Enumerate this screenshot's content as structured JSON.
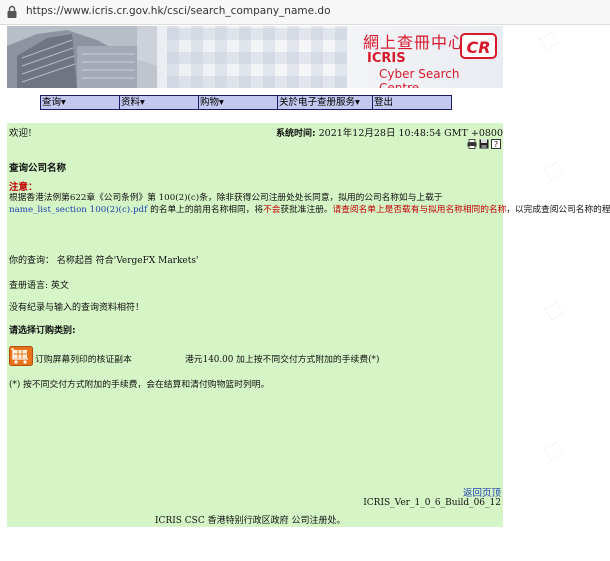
{
  "browser": {
    "url": "https://www.icris.cr.gov.hk/csci/search_company_name.do"
  },
  "banner": {
    "title_cn": "網上查冊中心",
    "title_en1": "ICRIS",
    "title_en2": "Cyber Search Centre",
    "logo": "CR"
  },
  "menu": {
    "items": [
      {
        "label": "查询▾"
      },
      {
        "label": "资料▾"
      },
      {
        "label": "购物▾"
      },
      {
        "label": "关於电子查册服务▾"
      },
      {
        "label": "登出"
      }
    ]
  },
  "main": {
    "welcome": "欢迎!",
    "system_time_label": "系统时间:",
    "system_time_value": "2021年12月28日 10:48:54 GMT +0800",
    "page_title": "查询公司名称",
    "notice_head": "注意：",
    "notice_text1": "根据香港法例第622章《公司条例》第 100(2)(c)条，除非获得公司注册处处长同意，拟用的公司名称如与上载于",
    "notice_link": "name_list_section 100(2)(c).pdf",
    "notice_text2": " 的名单上的前用名称相同，将",
    "notice_red1": "不会",
    "notice_text3": "获批准注册。",
    "notice_red2": "请查阅名单上是否载有与拟用名称相同的名称",
    "notice_text4": "，以完成查阅公司名称的程序。",
    "query_text": "你的查询： 名称起首 符合'VergeFX Markets'",
    "lang_text": "查册语言: 英文",
    "no_match": "没有纪录与输入的查询资料相符！",
    "choose_title": "请选择订购类别:",
    "order_item_label": "订购屏幕列印的核证副本",
    "order_item_price": "港元140.00 加上按不同交付方式附加的手续费(*)",
    "footnote": "(*) 按不同交付方式附加的手续费，会在结算和清付购物篮时列明。",
    "back_to_top": "返回页顶",
    "version": "ICRIS_Ver_1_0_6_Build_06_12",
    "footer": "ICRIS CSC 香港特别行政区政府 公司注册处。"
  },
  "colors": {
    "panel_bg": "#d6f5c6",
    "menu_bg": "#c2c8ee",
    "brand_red": "#d8192c",
    "link_blue": "#1a3fb0",
    "notice_red": "#c00000"
  },
  "icons": [
    "lock-icon",
    "printer-icon",
    "save-icon",
    "help-icon",
    "shopping-cart-icon"
  ]
}
